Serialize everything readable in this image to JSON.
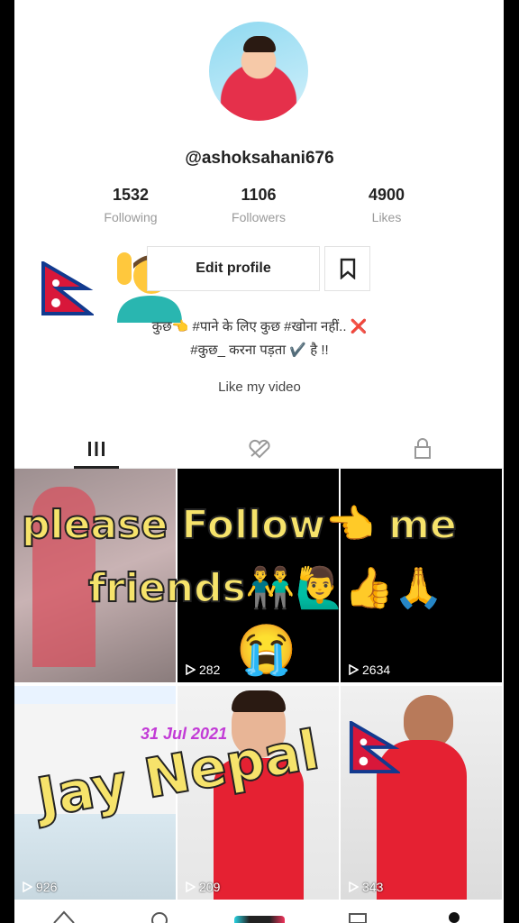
{
  "profile": {
    "username": "@ashoksahani676",
    "stats": [
      {
        "value": "1532",
        "label": "Following"
      },
      {
        "value": "1106",
        "label": "Followers"
      },
      {
        "value": "4900",
        "label": "Likes"
      }
    ],
    "edit_label": "Edit profile",
    "bio_line1": "कुछ👈 #पाने के लिए कुछ #खोना नहीं.. ❌",
    "bio_line2": "#कुछ_ करना पड़ता ✔️ है !!",
    "bio_line3": "Like my video"
  },
  "videos": [
    {
      "views": ""
    },
    {
      "views": "282"
    },
    {
      "views": "2634"
    },
    {
      "views": "926"
    },
    {
      "views": "209"
    },
    {
      "views": "343"
    }
  ],
  "overlay": {
    "line1": "please Follow👈 me",
    "line2": "friends👬🙋‍♂️👍🙏",
    "emoji": "😭",
    "date": "31 Jul 2021",
    "title": "Jay Nepal"
  },
  "colors": {
    "accent": "#f6e36b",
    "date": "#c23bd6"
  },
  "icons": [
    "grid-icon",
    "liked-icon",
    "lock-icon",
    "bookmark-icon",
    "play-icon",
    "home-icon",
    "search-icon",
    "plus-icon",
    "inbox-icon",
    "profile-icon"
  ]
}
